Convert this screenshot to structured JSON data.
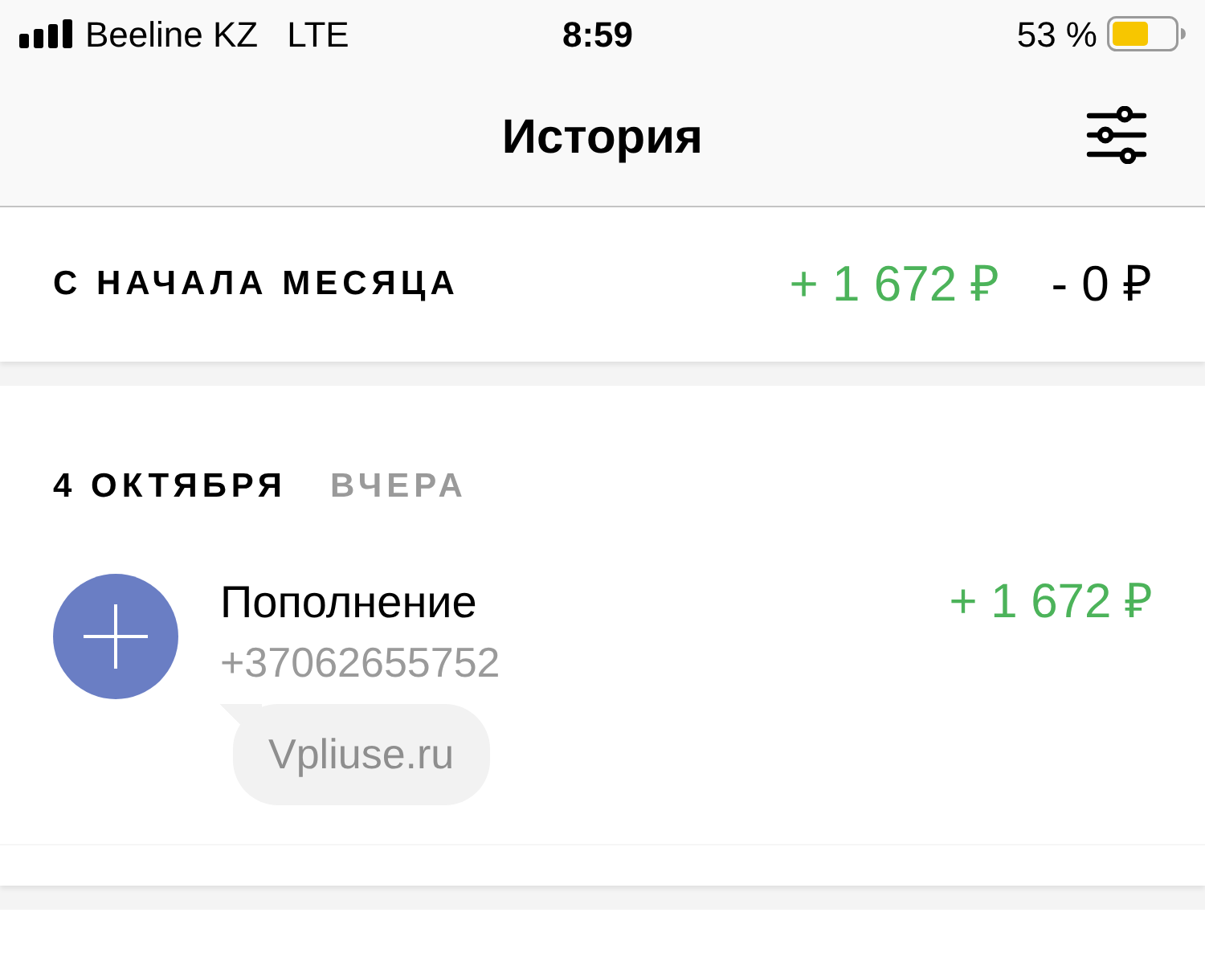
{
  "status_bar": {
    "carrier": "Beeline KZ",
    "network": "LTE",
    "time": "8:59",
    "battery_percent": "53 %"
  },
  "nav_bar": {
    "title": "История"
  },
  "month_summary": {
    "label": "С НАЧАЛА МЕСЯЦА",
    "income": "+ 1 672 ₽",
    "expense": "- 0 ₽"
  },
  "days": [
    {
      "date": "4 ОКТЯБРЯ",
      "relative": "ВЧЕРА",
      "transactions": [
        {
          "kind": "income",
          "title": "Пополнение",
          "subtitle": "+37062655752",
          "amount": "+ 1 672 ₽",
          "comment": "Vpliuse.ru"
        }
      ]
    }
  ]
}
